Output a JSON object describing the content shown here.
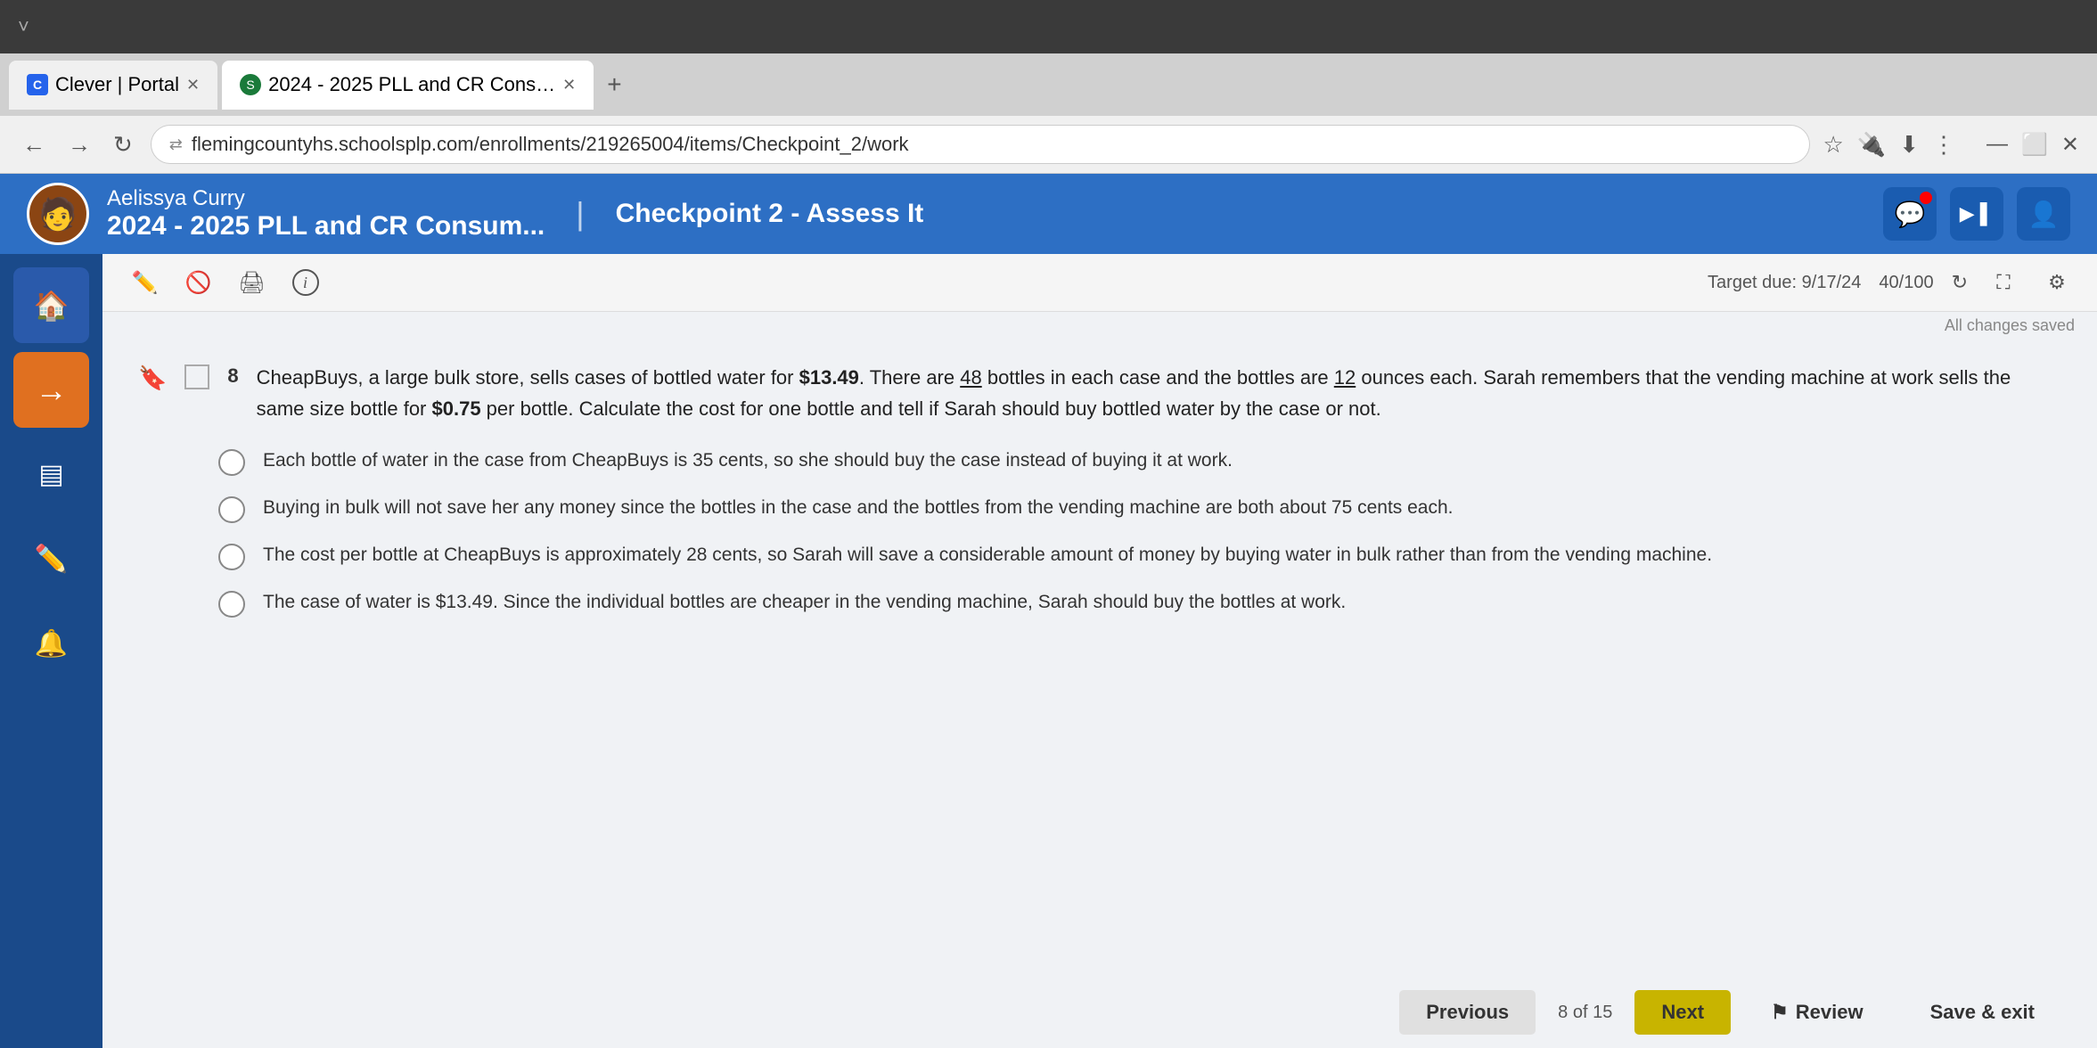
{
  "browser": {
    "tabs": [
      {
        "id": "tab1",
        "icon": "C",
        "label": "Clever | Portal",
        "active": false
      },
      {
        "id": "tab2",
        "icon": "S",
        "label": "2024 - 2025 PLL and CR Cons…",
        "active": true
      }
    ],
    "url": "flemingcountyhs.schoolsplp.com/enrollments/219265004/items/Checkpoint_2/work",
    "add_tab_label": "+"
  },
  "header": {
    "user_name": "Aelissya Curry",
    "course_title": "2024 - 2025 PLL and CR Consum...",
    "separator": "|",
    "checkpoint_label": "Checkpoint 2 - Assess It",
    "actions": {
      "chat": "💬",
      "video": "▶",
      "user": "👤"
    }
  },
  "toolbar": {
    "target_due_label": "Target due: 9/17/24",
    "score_label": "40/100",
    "saved_text": "All changes saved",
    "icons": {
      "pencil": "✏️",
      "block": "🚫",
      "print": "🖨",
      "info": "ℹ️",
      "expand": "⛶",
      "settings": "⚙"
    }
  },
  "sidebar": {
    "items": [
      {
        "id": "home",
        "icon": "🏠",
        "label": "Home",
        "active": false
      },
      {
        "id": "goto",
        "icon": "→",
        "label": "Go",
        "active": true
      },
      {
        "id": "layers",
        "icon": "▣",
        "label": "Layers",
        "active": false
      },
      {
        "id": "edit",
        "icon": "✏",
        "label": "Edit",
        "active": false
      },
      {
        "id": "bell",
        "icon": "🔔",
        "label": "Notifications",
        "active": false
      }
    ]
  },
  "question": {
    "number": "8",
    "text_part1": "CheapBuys, a large bulk store, sells cases of bottled water for ",
    "price1": "$13.49",
    "text_part2": ". There are ",
    "bottles": "48",
    "text_part3": " bottles in each case and the bottles are ",
    "ounces": "12",
    "text_part4": " ounces each. Sarah remembers that the vending machine at work sells the same size bottle for ",
    "price2": "$0.75",
    "text_part5": " per bottle. Calculate the cost for one bottle and tell if Sarah should buy bottled water by the case or not.",
    "options": [
      {
        "id": "A",
        "text": "Each bottle of water in the case from CheapBuys is 35 cents, so she should buy the case instead of buying it at work."
      },
      {
        "id": "B",
        "text": "Buying in bulk will not save her any money since the bottles in the case and the bottles from the vending machine are both about 75 cents each."
      },
      {
        "id": "C",
        "text": "The cost per bottle at CheapBuys is approximately 28 cents, so Sarah will save a considerable amount of money by buying water in bulk rather than from the vending machine."
      },
      {
        "id": "D",
        "text": "The case of water is $13.49. Since the individual bottles are cheaper in the vending machine, Sarah should buy the bottles at work."
      }
    ]
  },
  "navigation": {
    "previous_label": "Previous",
    "page_indicator": "8 of 15",
    "next_label": "Next",
    "review_label": "Review",
    "save_exit_label": "Save & exit"
  }
}
